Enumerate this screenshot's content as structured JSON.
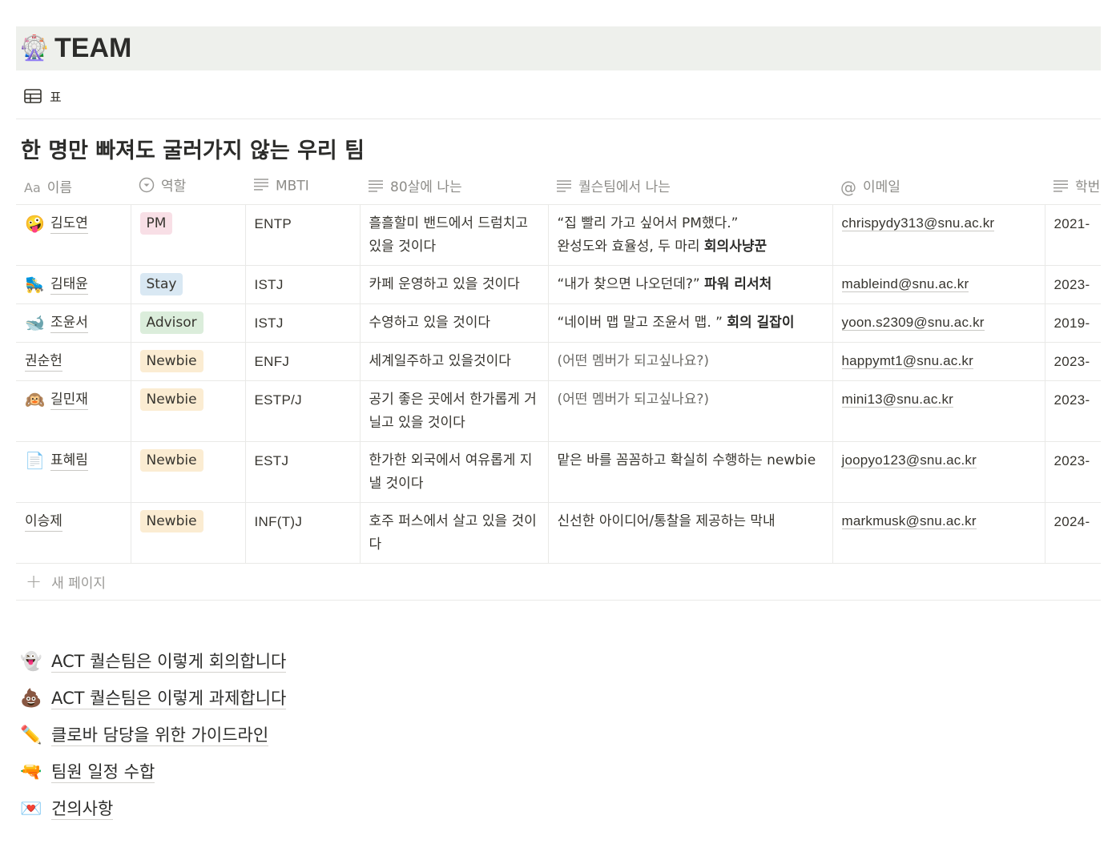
{
  "header": {
    "emoji": "🎡",
    "title": "TEAM"
  },
  "view": {
    "label": "표",
    "icon": "table-icon"
  },
  "database": {
    "title": "한 명만 빠져도 굴러가지 않는 우리 팀",
    "columns": [
      {
        "prefix": "Aa",
        "label": "이름"
      },
      {
        "icon": "select-icon",
        "label": "역할"
      },
      {
        "icon": "text-lines-icon",
        "label": "MBTI"
      },
      {
        "icon": "text-lines-icon",
        "label": "80살에 나는"
      },
      {
        "icon": "text-lines-icon",
        "label": "퀄슨팀에서 나는"
      },
      {
        "icon": "at-icon",
        "label": "이메일"
      },
      {
        "icon": "text-lines-icon",
        "label": "학번"
      }
    ],
    "rows": [
      {
        "emoji": "🤪",
        "name": "김도연",
        "role": "PM",
        "role_bg": "#f8dfe6",
        "mbti": "ENTP",
        "at80": "흘흘할미 밴드에서 드럼치고 있을 것이다",
        "team_line1": "“집 빨리 가고 싶어서 PM했다.”",
        "team_plain": "완성도와 효율성, 두 마리 ",
        "team_bold": "회의사냥꾼",
        "email": "chrispydy313@snu.ac.kr",
        "year": "2021-"
      },
      {
        "emoji": "🛼",
        "name": "김태윤",
        "role": "Stay",
        "role_bg": "#d9e8f3",
        "mbti": "ISTJ",
        "at80": "카페 운영하고 있을 것이다",
        "team_line1": "",
        "team_plain": "“내가 찾으면 나오던데?” ",
        "team_bold": "파워 리서처",
        "email": "mableind@snu.ac.kr",
        "year": "2023-"
      },
      {
        "emoji": "🐋",
        "name": "조윤서",
        "role": "Advisor",
        "role_bg": "#dbeddb",
        "mbti": "ISTJ",
        "at80": "수영하고 있을 것이다",
        "team_line1": "",
        "team_plain": "“네이버 맵 말고 조윤서 맵. ” ",
        "team_bold": "회의 길잡이",
        "email": "yoon.s2309@snu.ac.kr",
        "year": "2019-"
      },
      {
        "emoji": "",
        "name": "권순헌",
        "role": "Newbie",
        "role_bg": "#fbecd2",
        "mbti": "ENFJ",
        "at80": "세계일주하고 있을것이다",
        "team_line1": "",
        "team_plain": "(어떤 멤버가 되고싶나요?)",
        "team_bold": "",
        "email": "happymt1@snu.ac.kr",
        "year": "2023-"
      },
      {
        "emoji": "🙉",
        "name": "길민재",
        "role": "Newbie",
        "role_bg": "#fbecd2",
        "mbti": "ESTP/J",
        "at80": "공기 좋은 곳에서 한가롭게 거닐고 있을 것이다",
        "team_line1": "",
        "team_plain": "(어떤 멤버가 되고싶나요?)",
        "team_bold": "",
        "email": "mini13@snu.ac.kr",
        "year": "2023-"
      },
      {
        "emoji": "📄",
        "name": "표혜림",
        "role": "Newbie",
        "role_bg": "#fbecd2",
        "mbti": "ESTJ",
        "at80": "한가한 외국에서 여유롭게 지낼 것이다",
        "team_line1": "",
        "team_plain": "맡은 바를 꼼꼼하고 확실히 수행하는 newbie",
        "team_bold": "",
        "email": "joopyo123@snu.ac.kr",
        "year": "2023-"
      },
      {
        "emoji": "",
        "name": "이승제",
        "role": "Newbie",
        "role_bg": "#fbecd2",
        "mbti": "INF(T)J",
        "at80": "호주 퍼스에서 살고 있을 것이다",
        "team_line1": "",
        "team_plain": "신선한 아이디어/통찰을 제공하는 막내",
        "team_bold": "",
        "email": "markmusk@snu.ac.kr",
        "year": "2024-"
      }
    ],
    "new_page_label": "새 페이지"
  },
  "links": [
    {
      "emoji": "👻",
      "label": "ACT 퀄슨팀은 이렇게 회의합니다"
    },
    {
      "emoji": "💩",
      "label": "ACT 퀄슨팀은 이렇게 과제합니다"
    },
    {
      "emoji": "✏️",
      "label": "클로바 담당을 위한 가이드라인"
    },
    {
      "emoji": "🔫",
      "label": "팀원 일정 수합"
    },
    {
      "emoji": "💌",
      "label": "건의사항"
    }
  ]
}
